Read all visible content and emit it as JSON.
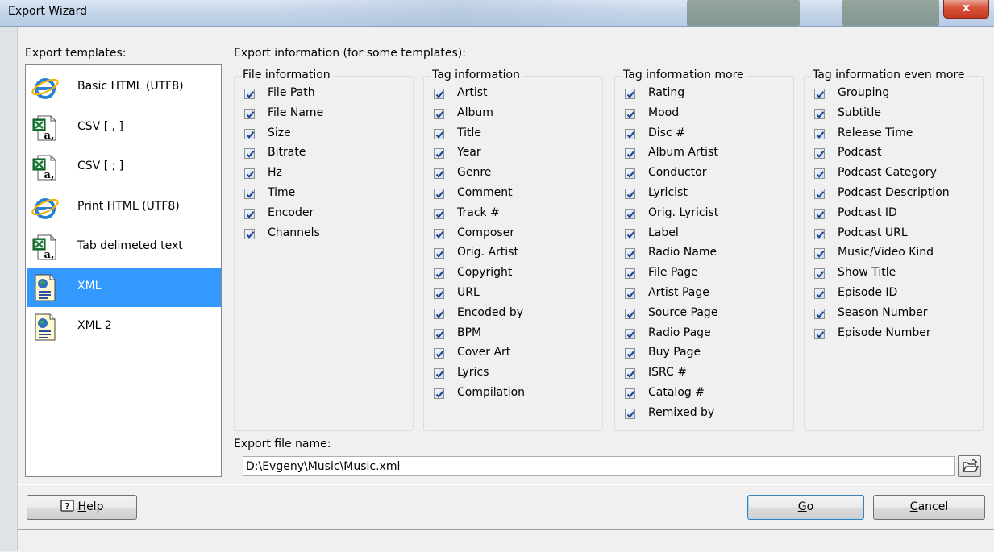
{
  "window": {
    "title": "Export Wizard",
    "close_label": "x"
  },
  "templates": {
    "label": "Export templates:",
    "items": [
      {
        "label": "Basic HTML (UTF8)",
        "icon": "ie-icon"
      },
      {
        "label": "CSV [ , ]",
        "icon": "excel-icon"
      },
      {
        "label": "CSV [ ; ]",
        "icon": "excel-icon"
      },
      {
        "label": "Print HTML (UTF8)",
        "icon": "ie-icon"
      },
      {
        "label": "Tab delimeted text",
        "icon": "excel-icon"
      },
      {
        "label": "XML",
        "icon": "xml-doc-icon"
      },
      {
        "label": "XML 2",
        "icon": "xml-doc-icon"
      }
    ],
    "selected": "XML"
  },
  "info": {
    "label": "Export information (for some templates):",
    "groups": [
      {
        "title": "File information",
        "items": [
          "File Path",
          "File Name",
          "Size",
          "Bitrate",
          "Hz",
          "Time",
          "Encoder",
          "Channels"
        ]
      },
      {
        "title": "Tag information",
        "items": [
          "Artist",
          "Album",
          "Title",
          "Year",
          "Genre",
          "Comment",
          "Track #",
          "Composer",
          "Orig. Artist",
          "Copyright",
          "URL",
          "Encoded by",
          "BPM",
          "Cover Art",
          "Lyrics",
          "Compilation"
        ]
      },
      {
        "title": "Tag information more",
        "items": [
          "Rating",
          "Mood",
          "Disc #",
          "Album Artist",
          "Conductor",
          "Lyricist",
          "Orig. Lyricist",
          "Label",
          "Radio Name",
          "File Page",
          "Artist Page",
          "Source Page",
          "Radio Page",
          "Buy Page",
          "ISRC #",
          "Catalog #",
          "Remixed by"
        ]
      },
      {
        "title": "Tag information even more",
        "items": [
          "Grouping",
          "Subtitle",
          "Release Time",
          "Podcast",
          "Podcast Category",
          "Podcast Description",
          "Podcast ID",
          "Podcast URL",
          "Music/Video Kind",
          "Show Title",
          "Episode ID",
          "Season Number",
          "Episode Number"
        ]
      }
    ],
    "all_checked": true
  },
  "filename": {
    "label": "Export file name:",
    "value": "D:\\Evgeny\\Music\\Music.xml"
  },
  "buttons": {
    "help_mnemonic": "H",
    "help_rest": "elp",
    "go_mnemonic": "G",
    "go_rest": "o",
    "cancel_mnemonic": "C",
    "cancel_rest": "ancel"
  },
  "colors": {
    "selection": "#3399ff",
    "title_bar": "#c4d5ea",
    "close_button": "#d8533b"
  }
}
